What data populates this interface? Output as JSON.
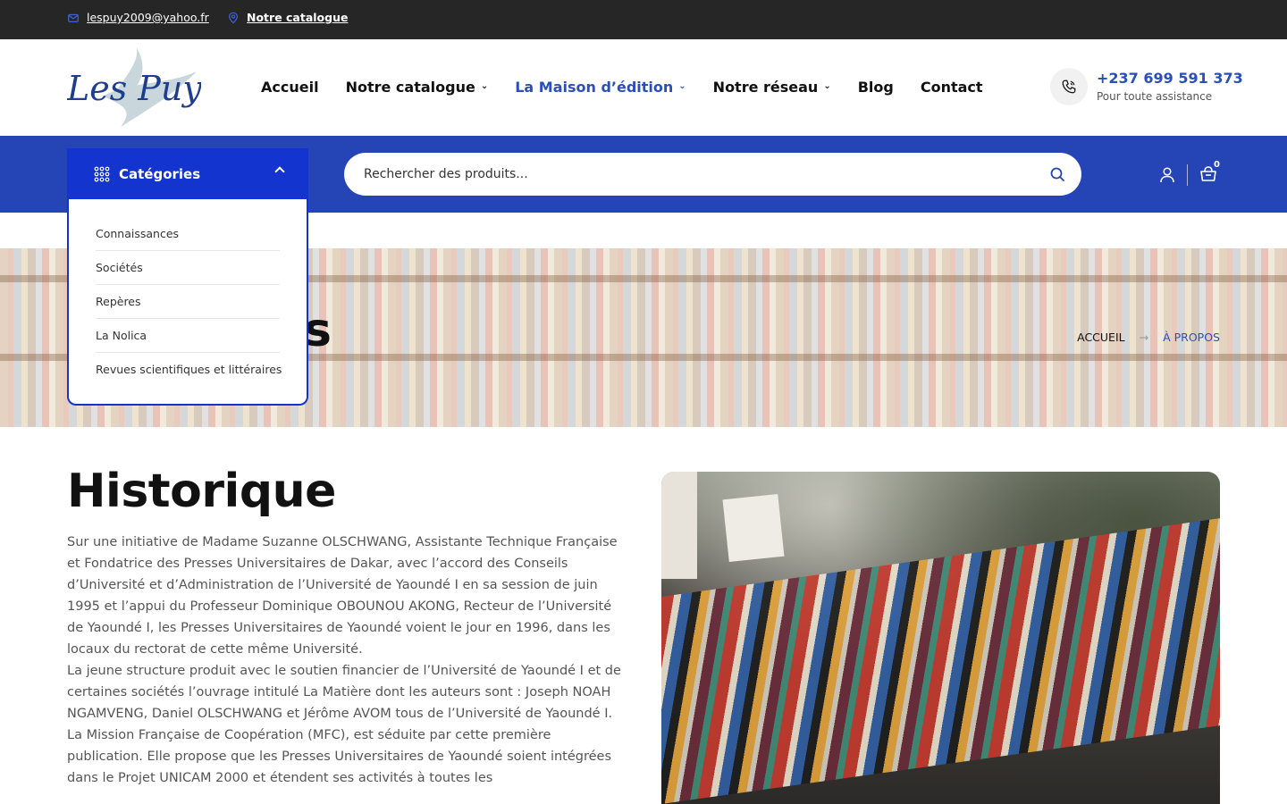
{
  "topbar": {
    "email": "lespuy2009@yahoo.fr",
    "catalogue": "Notre catalogue"
  },
  "header": {
    "logo_text": "Les Puy",
    "nav": [
      {
        "label": "Accueil",
        "dropdown": false
      },
      {
        "label": "Notre catalogue",
        "dropdown": true
      },
      {
        "label": "La Maison d’édition",
        "dropdown": true,
        "active": true
      },
      {
        "label": "Notre réseau",
        "dropdown": true
      },
      {
        "label": "Blog",
        "dropdown": false
      },
      {
        "label": "Contact",
        "dropdown": false
      }
    ],
    "phone": "+237 699 591 373",
    "phone_sub": "Pour toute assistance"
  },
  "band": {
    "categories_label": "Catégories",
    "search_placeholder": "Rechercher des produits...",
    "cart_count": "0"
  },
  "categories": [
    "Connaissances",
    "Sociétés",
    "Repères",
    "La Nolica",
    "Revues scientifiques et littéraires"
  ],
  "hero": {
    "title_visible": "s",
    "breadcrumb_home": "ACCUEIL",
    "breadcrumb_current": "À PROPOS"
  },
  "content": {
    "title": "Historique",
    "paragraphs": [
      "Sur une initiative de Madame Suzanne OLSCHWANG, Assistante Technique Française et Fondatrice des Presses Universitaires de Dakar, avec l’accord des Conseils d’Université et d’Administration de l’Université de Yaoundé I en sa session de juin 1995 et l’appui du Professeur Dominique OBOUNOU AKONG, Recteur de l’Université de Yaoundé I, les Presses Universitaires de Yaoundé voient le jour en 1996, dans les locaux du rectorat de cette même Université.",
      "La jeune structure produit avec le soutien financier de l’Université de Yaoundé I et de certaines sociétés l’ouvrage intitulé La Matière dont les auteurs sont : Joseph NOAH NGAMVENG, Daniel OLSCHWANG et Jérôme AVOM tous de l’Université de Yaoundé I.",
      "La Mission Française de Coopération (MFC), est séduite par cette première publication. Elle propose que les Presses Universitaires de Yaoundé soient intégrées dans le Projet UNICAM 2000 et étendent ses activités à toutes les"
    ]
  },
  "colors": {
    "topbar": "#262626",
    "brand_blue": "#2545b6",
    "accent_blue": "#1334cf",
    "link_blue": "#2a4fba"
  }
}
